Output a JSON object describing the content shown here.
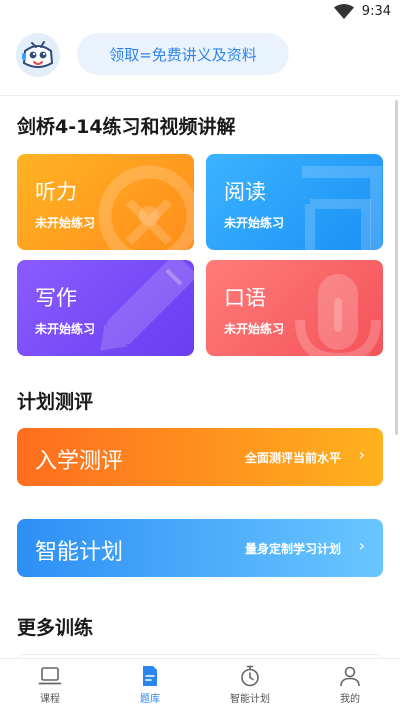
{
  "status_bar": {
    "time": "9:34"
  },
  "header": {
    "promo_label": "领取=免费讲义及资料"
  },
  "cambridge": {
    "title": "剑桥4-14练习和视频讲解",
    "cards": [
      {
        "label": "听力",
        "status": "未开始练习",
        "icon": "steering-wheel-icon"
      },
      {
        "label": "阅读",
        "status": "未开始练习",
        "icon": "book-icon"
      },
      {
        "label": "写作",
        "status": "未开始练习",
        "icon": "pencil-icon"
      },
      {
        "label": "口语",
        "status": "未开始练习",
        "icon": "microphone-icon"
      }
    ],
    "colors": {
      "listening": "#ff9d20",
      "reading": "#24a0fa",
      "writing": "#7a4cf8",
      "speaking": "#f96468"
    }
  },
  "plan": {
    "title": "计划测评",
    "entrance": {
      "label": "入学测评",
      "desc": "全面测评当前水平",
      "color": "#ff8a1f"
    },
    "smart": {
      "label": "智能计划",
      "desc": "量身定制学习计划",
      "color": "#3aa2f7"
    }
  },
  "more": {
    "title": "更多训练"
  },
  "tabbar": {
    "items": [
      {
        "label": "课程",
        "icon": "laptop-icon",
        "active": false
      },
      {
        "label": "题库",
        "icon": "document-icon",
        "active": true
      },
      {
        "label": "智能计划",
        "icon": "stopwatch-icon",
        "active": false
      },
      {
        "label": "我的",
        "icon": "person-icon",
        "active": false
      }
    ],
    "active_color": "#2b86ee"
  }
}
